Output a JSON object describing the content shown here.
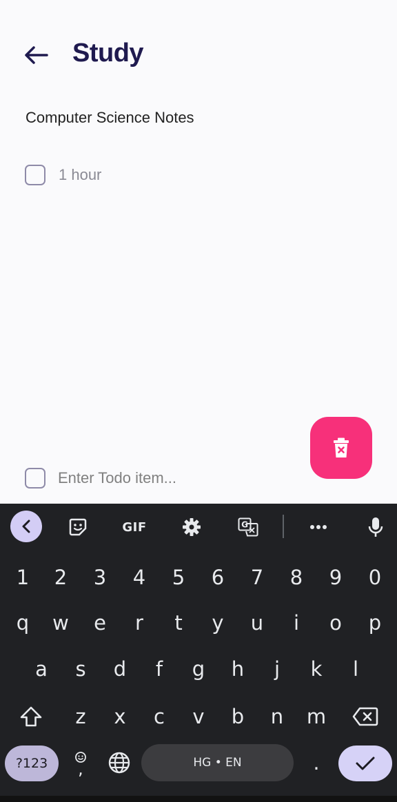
{
  "header": {
    "title": "Study"
  },
  "note": {
    "name": "Computer Science Notes"
  },
  "todos": [
    {
      "text": "1 hour",
      "checked": false
    }
  ],
  "new_todo": {
    "placeholder": "Enter Todo item..."
  },
  "fab": {
    "icon": "delete-icon",
    "color": "#f7307a"
  },
  "keyboard": {
    "toolbar": {
      "gif_label": "GIF"
    },
    "number_row": [
      "1",
      "2",
      "3",
      "4",
      "5",
      "6",
      "7",
      "8",
      "9",
      "0"
    ],
    "row1": [
      "q",
      "w",
      "e",
      "r",
      "t",
      "y",
      "u",
      "i",
      "o",
      "p"
    ],
    "row2": [
      "a",
      "s",
      "d",
      "f",
      "g",
      "h",
      "j",
      "k",
      "l"
    ],
    "row3": [
      "z",
      "x",
      "c",
      "v",
      "b",
      "n",
      "m"
    ],
    "symbols_label": "?123",
    "comma_label": ",",
    "period_label": ".",
    "space_label": "HG • EN"
  },
  "colors": {
    "accent": "#1f1a4f",
    "fab": "#f7307a",
    "keyboard_bg": "#202124"
  }
}
